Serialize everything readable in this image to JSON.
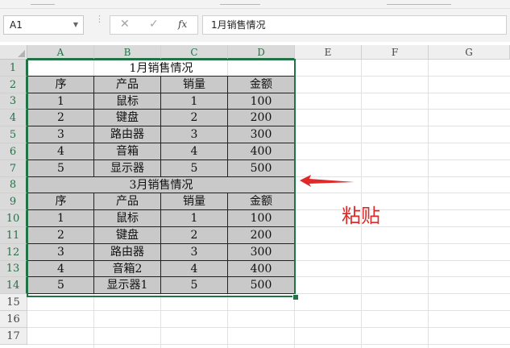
{
  "formula_bar": {
    "name_box": "A1",
    "cancel_icon": "✕",
    "enter_icon": "✓",
    "fx_label": "fx",
    "formula": "1月销售情况"
  },
  "columns": [
    "A",
    "B",
    "C",
    "D",
    "E",
    "F",
    "G"
  ],
  "rows": [
    "1",
    "2",
    "3",
    "4",
    "5",
    "6",
    "7",
    "8",
    "9",
    "10",
    "11",
    "12",
    "13",
    "14",
    "15",
    "16",
    "17"
  ],
  "table1": {
    "title": "1月销售情况",
    "headers": [
      "序",
      "产品",
      "销量",
      "金额"
    ],
    "rows": [
      [
        "1",
        "鼠标",
        "1",
        "100"
      ],
      [
        "2",
        "键盘",
        "2",
        "200"
      ],
      [
        "3",
        "路由器",
        "3",
        "300"
      ],
      [
        "4",
        "音箱",
        "4",
        "400"
      ],
      [
        "5",
        "显示器",
        "5",
        "500"
      ]
    ]
  },
  "table2": {
    "title": "3月销售情况",
    "headers": [
      "序",
      "产品",
      "销量",
      "金额"
    ],
    "rows": [
      [
        "1",
        "鼠标",
        "1",
        "100"
      ],
      [
        "2",
        "键盘",
        "2",
        "200"
      ],
      [
        "3",
        "路由器",
        "3",
        "300"
      ],
      [
        "4",
        "音箱2",
        "4",
        "400"
      ],
      [
        "5",
        "显示器1",
        "5",
        "500"
      ]
    ]
  },
  "annotation": {
    "label": "粘贴",
    "color": "#e02a2a"
  },
  "colors": {
    "accent": "#217346",
    "cell_fill": "#c9c9c9"
  }
}
